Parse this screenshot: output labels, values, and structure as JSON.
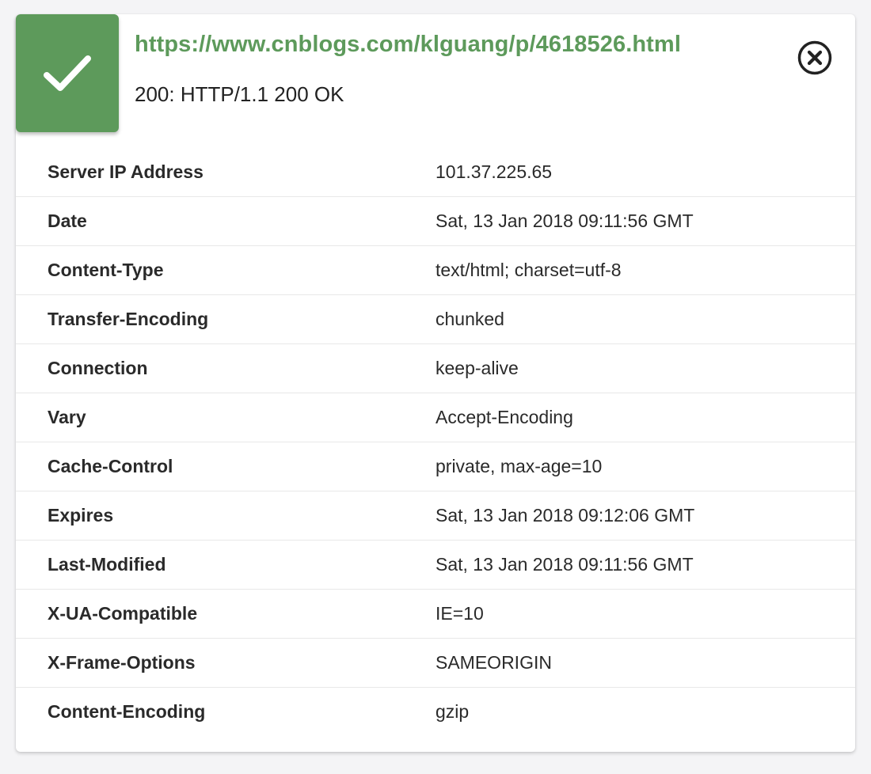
{
  "result": {
    "url": "https://www.cnblogs.com/klguang/p/4618526.html",
    "status_line": "200: HTTP/1.1 200 OK",
    "status_icon": "checkmark-icon",
    "close_icon": "close-circle-icon"
  },
  "colors": {
    "success_green": "#5d9a5b",
    "text_dark": "#2a2a2a",
    "divider": "#e8e8e8"
  },
  "headers": [
    {
      "key": "Server IP Address",
      "value": "101.37.225.65"
    },
    {
      "key": "Date",
      "value": "Sat, 13 Jan 2018 09:11:56 GMT"
    },
    {
      "key": "Content-Type",
      "value": "text/html; charset=utf-8"
    },
    {
      "key": "Transfer-Encoding",
      "value": "chunked"
    },
    {
      "key": "Connection",
      "value": "keep-alive"
    },
    {
      "key": "Vary",
      "value": "Accept-Encoding"
    },
    {
      "key": "Cache-Control",
      "value": "private, max-age=10"
    },
    {
      "key": "Expires",
      "value": "Sat, 13 Jan 2018 09:12:06 GMT"
    },
    {
      "key": "Last-Modified",
      "value": "Sat, 13 Jan 2018 09:11:56 GMT"
    },
    {
      "key": "X-UA-Compatible",
      "value": "IE=10"
    },
    {
      "key": "X-Frame-Options",
      "value": "SAMEORIGIN"
    },
    {
      "key": "Content-Encoding",
      "value": "gzip"
    }
  ]
}
